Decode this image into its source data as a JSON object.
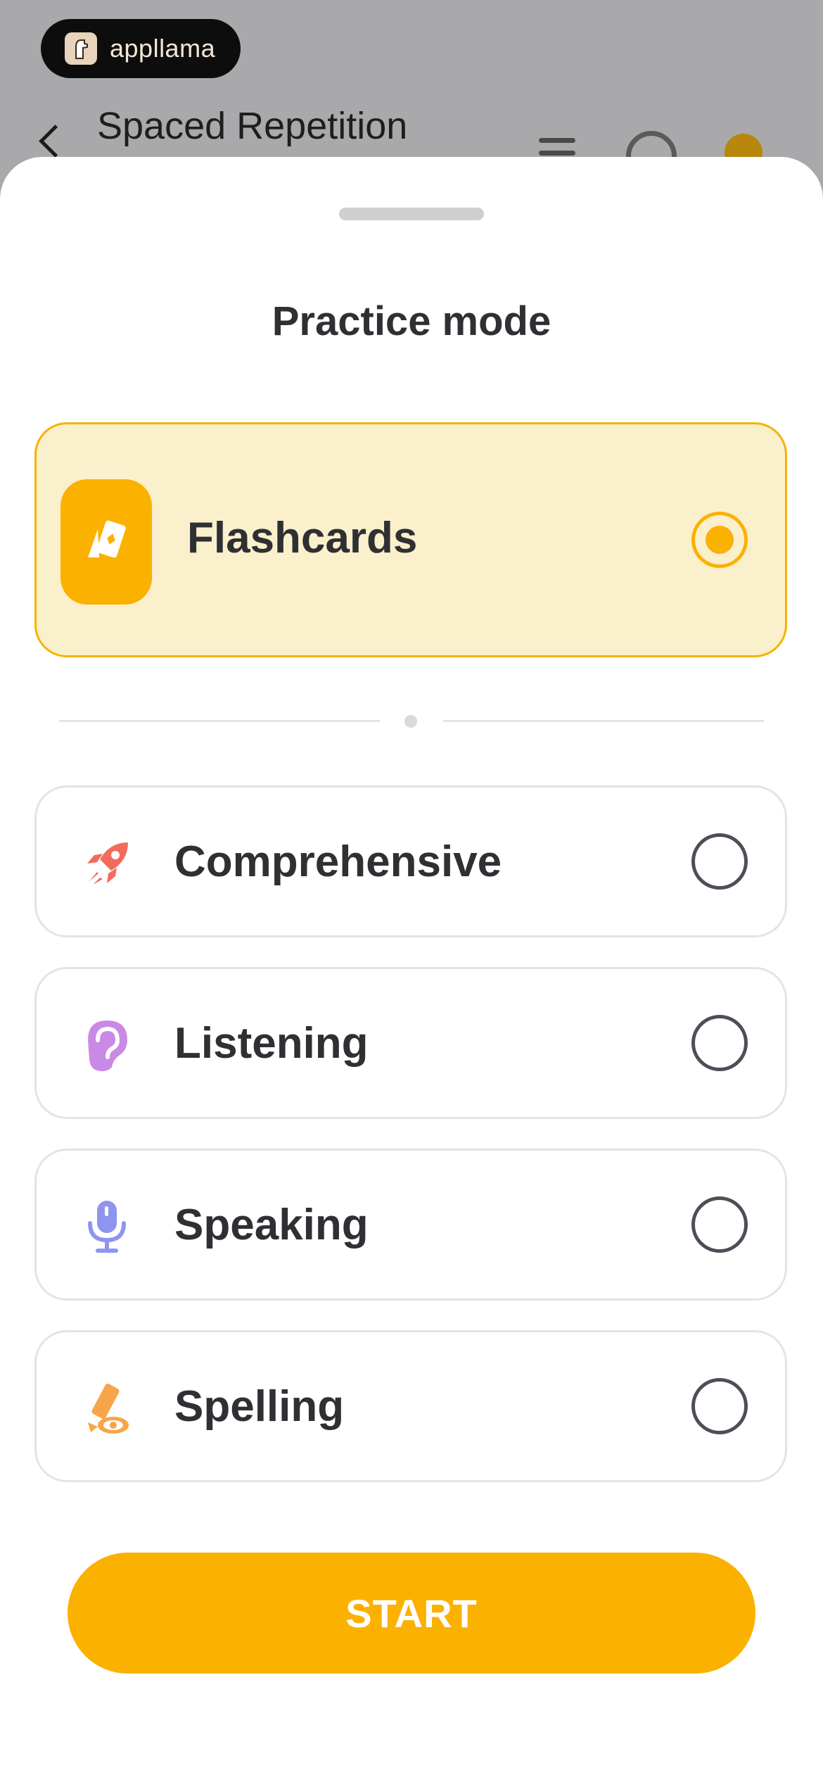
{
  "background": {
    "brand_name": "appllama",
    "screen_title": "Spaced Repetition"
  },
  "sheet": {
    "title": "Practice mode"
  },
  "options": [
    {
      "label": "Flashcards",
      "icon": "flashcards-icon",
      "selected": true
    },
    {
      "label": "Comprehensive",
      "icon": "rocket-icon",
      "selected": false
    },
    {
      "label": "Listening",
      "icon": "ear-icon",
      "selected": false
    },
    {
      "label": "Speaking",
      "icon": "microphone-icon",
      "selected": false
    },
    {
      "label": "Spelling",
      "icon": "pencil-eye-icon",
      "selected": false
    }
  ],
  "actions": {
    "start_label": "START"
  },
  "colors": {
    "accent": "#fbb100",
    "selected_bg": "#fbf0cc",
    "rocket": "#f36b5b",
    "ear": "#c98ae6",
    "microphone": "#8f95ef",
    "pencil": "#f7a44a"
  }
}
